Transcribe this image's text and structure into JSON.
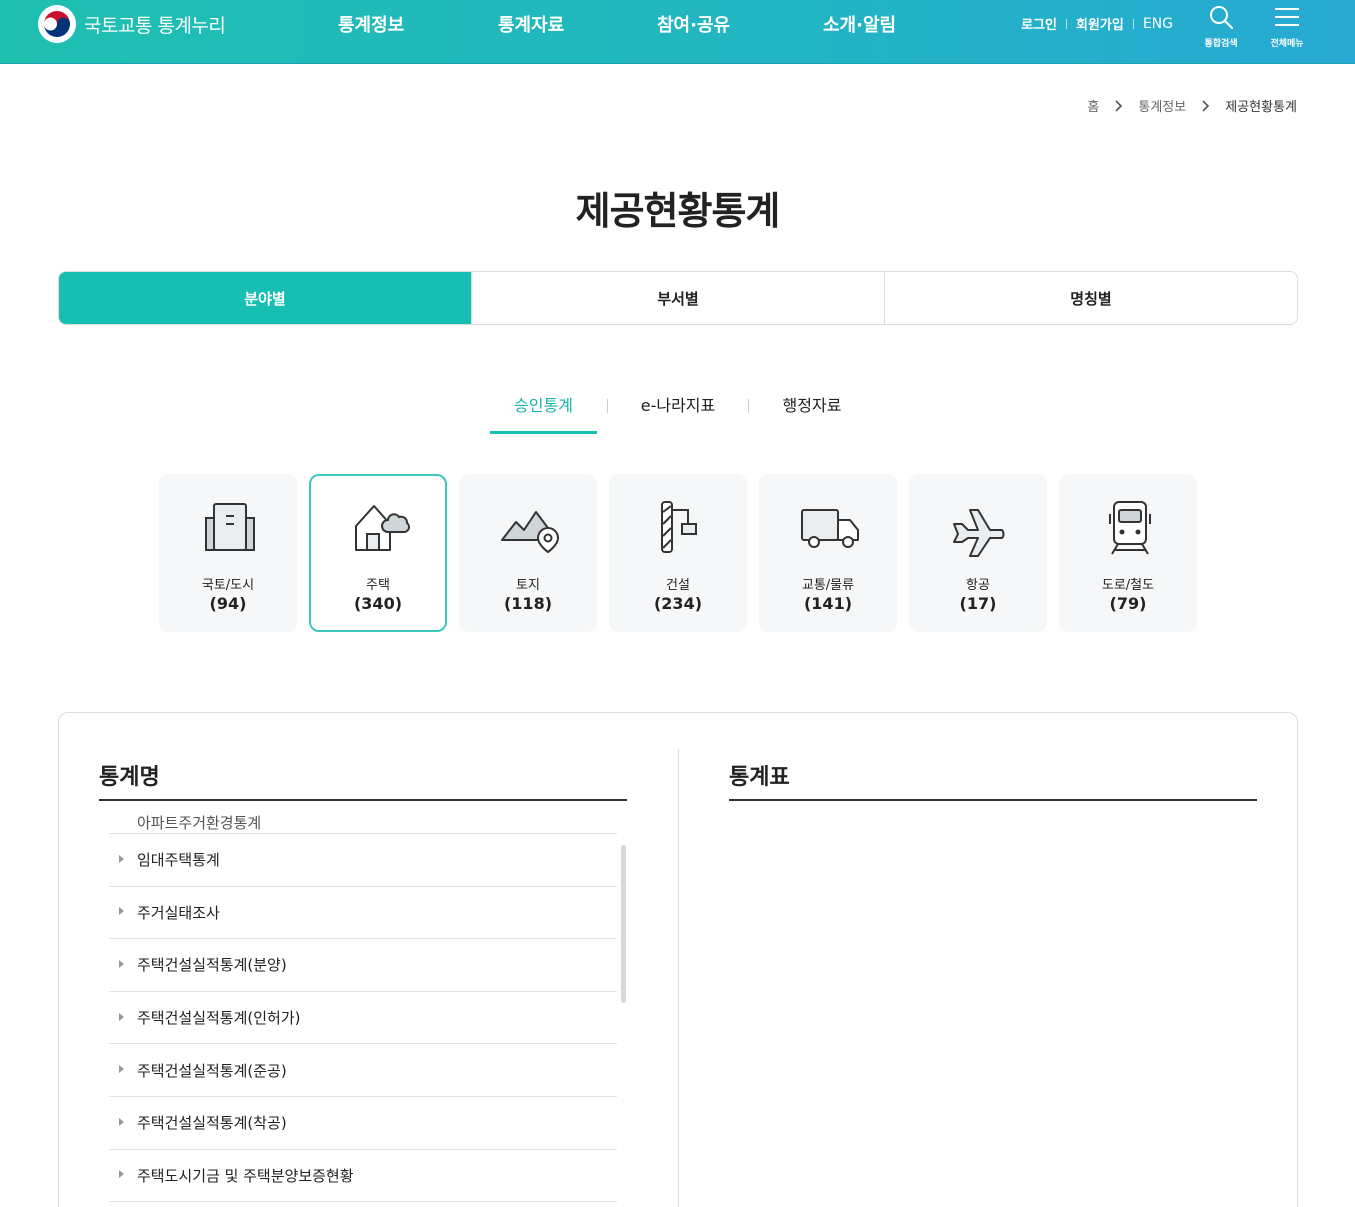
{
  "header": {
    "logo_text": "국토교통 통계누리",
    "nav": [
      "통계정보",
      "통계자료",
      "참여·공유",
      "소개·알림"
    ],
    "login": "로그인",
    "signup": "회원가입",
    "eng": "ENG",
    "search_label": "통합검색",
    "menu_label": "전체메뉴"
  },
  "breadcrumb": {
    "home": "홈",
    "level1": "통계정보",
    "current": "제공현황통계"
  },
  "page_title": "제공현황통계",
  "main_tabs": [
    "분야별",
    "부서별",
    "명칭별"
  ],
  "sub_tabs": [
    "승인통계",
    "e-나라지표",
    "행정자료"
  ],
  "categories": [
    {
      "name": "국토/도시",
      "count": "(94)",
      "icon": "building-icon"
    },
    {
      "name": "주택",
      "count": "(340)",
      "icon": "house-icon"
    },
    {
      "name": "토지",
      "count": "(118)",
      "icon": "land-icon"
    },
    {
      "name": "건설",
      "count": "(234)",
      "icon": "crane-icon"
    },
    {
      "name": "교통/물류",
      "count": "(141)",
      "icon": "truck-icon"
    },
    {
      "name": "항공",
      "count": "(17)",
      "icon": "airplane-icon"
    },
    {
      "name": "도로/철도",
      "count": "(79)",
      "icon": "train-icon"
    }
  ],
  "panel": {
    "left_title": "통계명",
    "right_title": "통계표",
    "list": [
      "아파트주거환경통계",
      "임대주택통계",
      "주거실태조사",
      "주택건설실적통계(분양)",
      "주택건설실적통계(인허가)",
      "주택건설실적통계(준공)",
      "주택건설실적통계(착공)",
      "주택도시기금 및 주택분양보증현황"
    ]
  },
  "colors": {
    "accent": "#17bfb2",
    "header_start": "#1fbfb0",
    "header_end": "#27a9d3"
  }
}
